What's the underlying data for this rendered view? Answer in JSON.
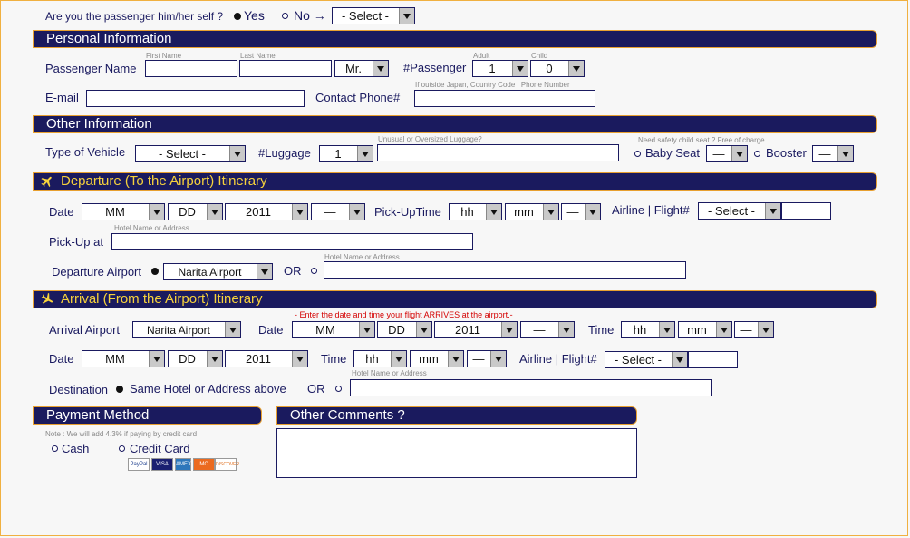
{
  "passenger_q": {
    "question": "Are you the passenger him/her self ?",
    "yes": "Yes",
    "no": "No →",
    "select": "- Select -"
  },
  "sections": {
    "personal": "Personal Information",
    "other": "Other Information",
    "departure": "Departure (To the Airport) Itinerary",
    "arrival": "Arrival (From the Airport) Itinerary",
    "payment": "Payment Method",
    "comments": "Other Comments ?"
  },
  "personal": {
    "name_label": "Passenger Name",
    "first_hint": "First Name",
    "last_hint": "Last Name",
    "title": "Mr.",
    "passenger_label": "#Passenger",
    "adult_hint": "Adult",
    "child_hint": "Child",
    "adult": "1",
    "child": "0",
    "email_label": "E-mail",
    "phone_label": "Contact Phone#",
    "phone_hint": "If outside Japan, Country Code | Phone Number"
  },
  "other": {
    "vehicle_label": "Type of Vehicle",
    "vehicle": "- Select -",
    "luggage_label": "#Luggage",
    "luggage": "1",
    "oversized_hint": "Unusual or Oversized Luggage?",
    "child_seat_hint": "Need safety child seat ? Free of charge",
    "baby_seat": "Baby Seat",
    "booster": "Booster",
    "dash": "—"
  },
  "departure": {
    "date_label": "Date",
    "mm": "MM",
    "dd": "DD",
    "year": "2011",
    "dash": "—",
    "pickup_time_label": "Pick-UpTime",
    "hh": "hh",
    "min": "mm",
    "airline_label": "Airline | Flight#",
    "airline": "- Select -",
    "pickup_label": "Pick-Up at",
    "hotel_hint": "Hotel Name or Address",
    "airport_label": "Departure Airport",
    "airport": "Narita Airport",
    "or": "OR",
    "hotel_hint2": "Hotel Name or Address"
  },
  "arrival": {
    "airport_label": "Arrival Airport",
    "airport": "Narita Airport",
    "date_label": "Date",
    "note": "- Enter the date and time your flight ARRIVES at the airport.-",
    "mm": "MM",
    "dd": "DD",
    "year": "2011",
    "dash": "—",
    "time_label": "Time",
    "hh": "hh",
    "min": "mm",
    "date2_label": "Date",
    "time2_label": "Time",
    "airline_label": "Airline | Flight#",
    "airline": "- Select -",
    "hotel_hint": "Hotel Name or Address",
    "dest_label": "Destination",
    "same_hotel": "Same Hotel or Address above",
    "or": "OR"
  },
  "payment": {
    "note": "Note : We will add 4.3% if paying by credit card",
    "cash": "Cash",
    "credit": "Credit Card",
    "cards": [
      "PayPal",
      "VISA",
      "AMEX",
      "MC",
      "DISCOVER"
    ]
  },
  "colors": {
    "navy": "#1a1a5e",
    "orange": "#e8a030",
    "yellow": "#f7d23c",
    "red": "#d40000"
  }
}
